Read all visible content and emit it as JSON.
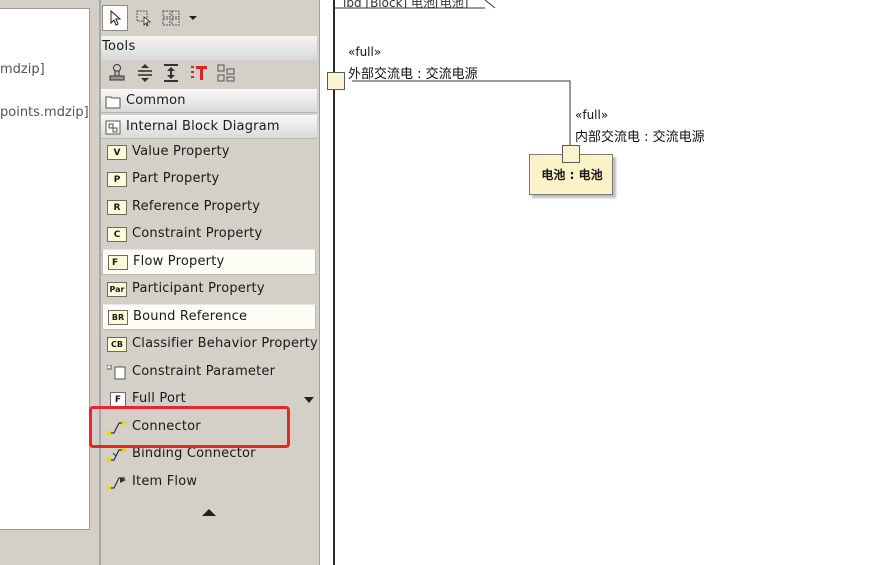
{
  "browser": {
    "items": [
      "mdzip]",
      "points.mdzip]"
    ]
  },
  "palette": {
    "tools_header": "Tools",
    "groups": {
      "common": "Common",
      "ibd": "Internal Block Diagram"
    },
    "items": [
      {
        "icon_text": "V",
        "label": "Value Property"
      },
      {
        "icon_text": "P",
        "label": "Part Property"
      },
      {
        "icon_text": "R",
        "label": "Reference Property"
      },
      {
        "icon_text": "C",
        "label": "Constraint Property"
      },
      {
        "icon_text": "F",
        "label": "Flow Property"
      },
      {
        "icon_text": "Par",
        "label": "Participant Property"
      },
      {
        "icon_text": "BR",
        "label": "Bound Reference"
      },
      {
        "icon_text": "CB",
        "label": "Classifier Behavior Property"
      },
      {
        "icon_text": "",
        "label": "Constraint Parameter"
      },
      {
        "icon_text": "F",
        "label": "Full Port"
      },
      {
        "icon_text": "",
        "label": "Connector"
      },
      {
        "icon_text": "",
        "label": "Binding Connector"
      },
      {
        "icon_text": "",
        "label": "Item Flow"
      }
    ]
  },
  "diagram": {
    "frame_tab": "ibd [Block] 电池[电池]",
    "port_outer": {
      "stereotype": "«full»",
      "label": "外部交流电 : 交流电源"
    },
    "port_inner": {
      "stereotype": "«full»",
      "label": "内部交流电 : 交流电源"
    },
    "part": {
      "label": "电池 : 电池"
    }
  },
  "colors": {
    "highlight": "#e8262a",
    "part_fill": "#fcf2c8",
    "port_fill": "#fbf3cf",
    "palette_bg": "#d4d0c8"
  }
}
